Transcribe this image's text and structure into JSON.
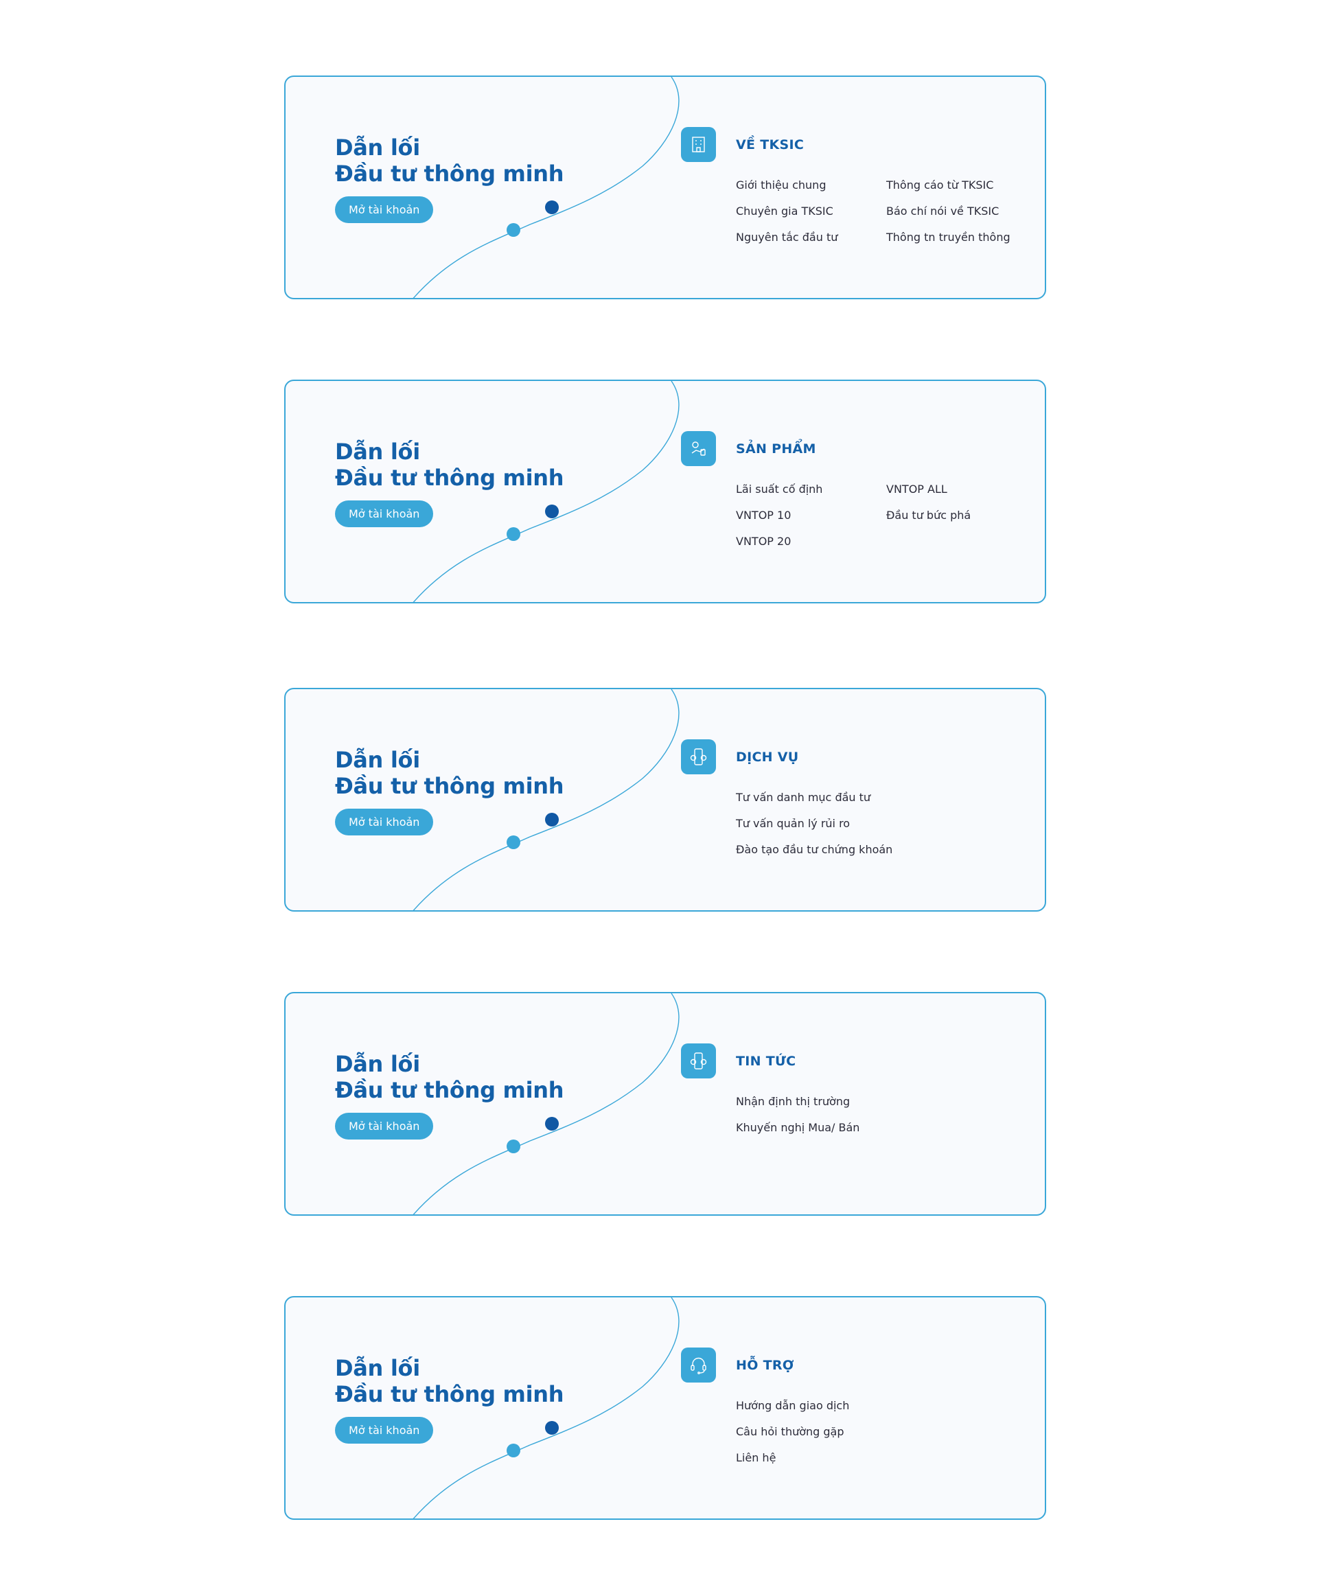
{
  "colors": {
    "brand_dark": "#1460a8",
    "brand_light": "#3aa7d8",
    "card_bg": "#f8fafd",
    "text": "#2c2c3a"
  },
  "cards": [
    {
      "hero": {
        "line1": "Dẫn lối",
        "line2": "Đầu tư thông minh",
        "button": "Mở tài khoản"
      },
      "menu": {
        "icon": "building-icon",
        "title": "VỀ TKSIC",
        "links": [
          "Giới thiệu chung",
          "Thông cáo từ TKSIC",
          "Chuyên gia TKSIC",
          "Báo chí nói về TKSIC",
          "Nguyên tắc đầu tư",
          "Thông tn truyền thông"
        ]
      }
    },
    {
      "hero": {
        "line1": "Dẫn lối",
        "line2": "Đầu tư thông minh",
        "button": "Mở tài khoản"
      },
      "menu": {
        "icon": "hand-coin-icon",
        "title": "SẢN PHẨM",
        "links": [
          "Lãi suất cố định",
          "VNTOP ALL",
          "VNTOP 10",
          "Đầu tư bức phá",
          "VNTOP 20"
        ]
      }
    },
    {
      "hero": {
        "line1": "Dẫn lối",
        "line2": "Đầu tư thông minh",
        "button": "Mở tài khoản"
      },
      "menu": {
        "icon": "phone-exchange-icon",
        "title": "DỊCH VỤ",
        "links": [
          "Tư vấn danh mục đầu tư",
          "Tư vấn quản lý rủi ro",
          "Đào tạo đầu tư chứng khoán"
        ]
      }
    },
    {
      "hero": {
        "line1": "Dẫn lối",
        "line2": "Đầu tư thông minh",
        "button": "Mở tài khoản"
      },
      "menu": {
        "icon": "phone-exchange-icon",
        "title": "TIN TỨC",
        "links": [
          "Nhận định thị trường",
          "Khuyến nghị Mua/ Bán"
        ]
      }
    },
    {
      "hero": {
        "line1": "Dẫn lối",
        "line2": "Đầu tư thông minh",
        "button": "Mở tài khoản"
      },
      "menu": {
        "icon": "headset-icon",
        "title": "HỖ TRỢ",
        "links": [
          "Hướng dẫn giao dịch",
          "Câu hỏi thường gặp",
          "Liên hệ"
        ]
      }
    }
  ]
}
